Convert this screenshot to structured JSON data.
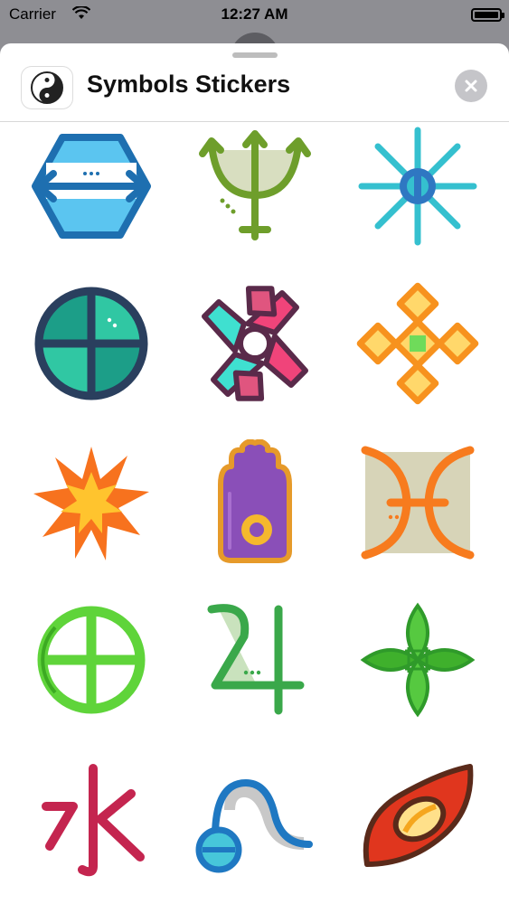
{
  "status_bar": {
    "carrier": "Carrier",
    "time": "12:27 AM"
  },
  "sheet": {
    "title": "Symbols Stickers",
    "app_icon": "yin-yang-icon",
    "close_icon": "close-icon"
  },
  "stickers": [
    "hexagon-arrows-sticker",
    "trident-sticker",
    "sun-rays-sticker",
    "quartered-circle-sticker",
    "pinwheel-sticker",
    "diamond-cross-sticker",
    "starburst-sticker",
    "jain-hand-sticker",
    "pisces-sticker",
    "sun-cross-sticker",
    "jupiter-sticker",
    "four-leaf-sticker",
    "water-kanji-sticker",
    "aquarius-wave-sticker",
    "eye-swirl-sticker"
  ],
  "colors": {
    "backdrop": "#8e8e93",
    "sheet": "#ffffff",
    "close_button": "#c5c5c9"
  }
}
